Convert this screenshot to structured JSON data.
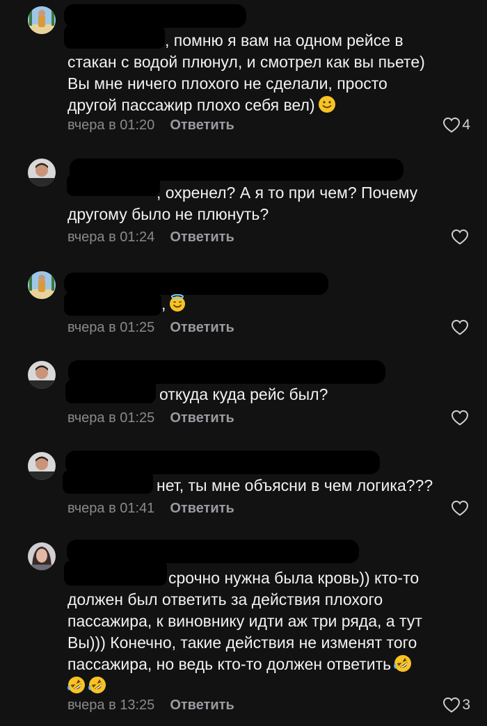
{
  "comments": [
    {
      "text": ", помню я вам на одном рейсе в\nстакан с водой плюнул, и смотрел как вы пьете)\nВы мне ничего плохого не сделали, просто\nдругой пассажир плохо себя вел)",
      "emoji": [
        "slightly-smiling-face"
      ],
      "time": "вчера в 01:20",
      "reply_label": "Ответить",
      "likes": "4",
      "avatar": "user-avatar-beach"
    },
    {
      "text": ", охренел? А я то при чем? Почему\nдругому было не плюнуть?",
      "emoji": [],
      "time": "вчера в 01:24",
      "reply_label": "Ответить",
      "likes": "",
      "avatar": "user-avatar-man"
    },
    {
      "text": ",",
      "emoji": [
        "smiling-face-with-halo"
      ],
      "time": "вчера в 01:25",
      "reply_label": "Ответить",
      "likes": "",
      "avatar": "user-avatar-beach"
    },
    {
      "text": "откуда куда рейс был?",
      "emoji": [],
      "time": "вчера в 01:25",
      "reply_label": "Ответить",
      "likes": "",
      "avatar": "user-avatar-man"
    },
    {
      "text": "нет, ты мне объясни в чем логика???",
      "emoji": [],
      "time": "вчера в 01:41",
      "reply_label": "Ответить",
      "likes": "",
      "avatar": "user-avatar-man"
    },
    {
      "text": "срочно нужна была кровь)) кто-то\nдолжен был ответить за действия плохого\nпассажира, к виновнику идти аж три ряда, а тут\nВы))) Конечно, такие действия не изменят того\nпассажира, но ведь кто-то должен ответить",
      "emoji": [
        "rolling-on-floor-laughing",
        "rolling-on-floor-laughing",
        "rolling-on-floor-laughing"
      ],
      "time": "вчера в 13:25",
      "reply_label": "Ответить",
      "likes": "3",
      "avatar": "user-avatar-woman"
    }
  ],
  "colors": {
    "background": "#121212",
    "text": "#f2f2f2",
    "meta": "#8a8a8e",
    "emoji_yellow": "#f7c325"
  }
}
